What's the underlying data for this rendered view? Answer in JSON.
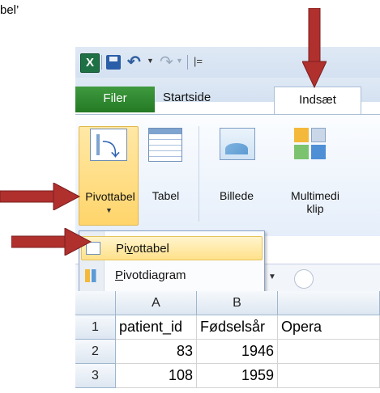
{
  "intro_text": "bel’",
  "quick_access": {
    "app_icon": "X",
    "customize": "|="
  },
  "tabs": [
    {
      "label": "Filer"
    },
    {
      "label": "Startside"
    },
    {
      "label": "Indsæt",
      "active": true
    }
  ],
  "ribbon": {
    "pivot_label": "Pivottabel",
    "table_label": "Tabel",
    "picture_label": "Billede",
    "clipart_label_line1": "Multimedi",
    "clipart_label_line2": "klip"
  },
  "menu": {
    "item1": {
      "prefix": "Pi",
      "underline": "v",
      "suffix": "ottabel",
      "icon": "pivot-table-icon"
    },
    "item2": {
      "prefix": "",
      "underline": "P",
      "suffix": "ivotdiagram",
      "icon": "pivot-chart-icon"
    }
  },
  "grid": {
    "columns": [
      "A",
      "B",
      ""
    ],
    "rows": [
      {
        "num": "1",
        "cells": [
          "patient_id",
          "Fødselsår",
          "Opera"
        ]
      },
      {
        "num": "2",
        "cells": [
          "83",
          "1946",
          ""
        ]
      },
      {
        "num": "3",
        "cells": [
          "108",
          "1959",
          ""
        ]
      }
    ]
  },
  "colors": {
    "file_tab": "#2b7d2b",
    "highlight": "#ffd56b",
    "arrow": "#b0302e"
  }
}
